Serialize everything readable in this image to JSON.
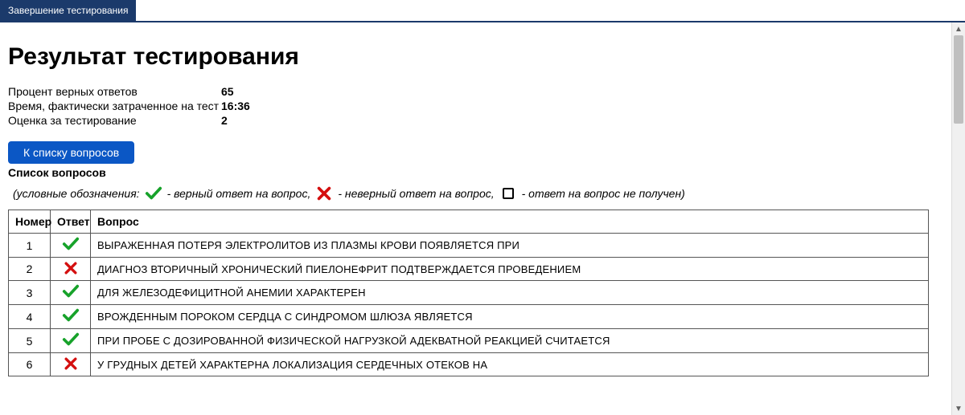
{
  "top_tab": "Завершение тестирования",
  "title": "Результат тестирования",
  "stats": {
    "rows": [
      {
        "label": "Процент верных ответов",
        "value": "65"
      },
      {
        "label": "Время, фактически затраченное на тест",
        "value": "16:36"
      },
      {
        "label": "Оценка за тестирование",
        "value": "2"
      }
    ]
  },
  "button_list_label": "К списку вопросов",
  "list_title": "Список вопросов",
  "legend": {
    "prefix": "(условные обозначения:",
    "correct": " - верный ответ на вопрос,",
    "wrong": " - неверный ответ на вопрос,",
    "none": " - ответ на вопрос не получен)"
  },
  "icons": {
    "check_color": "#17a22a",
    "cross_color": "#d40f0f"
  },
  "table": {
    "headers": {
      "num": "Номер",
      "ans": "Ответ",
      "q": "Вопрос"
    },
    "rows": [
      {
        "num": "1",
        "status": "correct",
        "q": "ВЫРАЖЕННАЯ ПОТЕРЯ ЭЛЕКТРОЛИТОВ ИЗ ПЛАЗМЫ КРОВИ ПОЯВЛЯЕТСЯ ПРИ"
      },
      {
        "num": "2",
        "status": "wrong",
        "q": "ДИАГНОЗ ВТОРИЧНЫЙ ХРОНИЧЕСКИЙ ПИЕЛОНЕФРИТ ПОДТВЕРЖДАЕТСЯ ПРОВЕДЕНИЕМ"
      },
      {
        "num": "3",
        "status": "correct",
        "q": "ДЛЯ ЖЕЛЕЗОДЕФИЦИТНОЙ АНЕМИИ ХАРАКТЕРЕН"
      },
      {
        "num": "4",
        "status": "correct",
        "q": "ВРОЖДЕННЫМ ПОРОКОМ СЕРДЦА С СИНДРОМОМ ШЛЮЗА ЯВЛЯЕТСЯ"
      },
      {
        "num": "5",
        "status": "correct",
        "q": "ПРИ ПРОБЕ С ДОЗИРОВАННОЙ ФИЗИЧЕСКОЙ НАГРУЗКОЙ АДЕКВАТНОЙ РЕАКЦИЕЙ СЧИТАЕТСЯ"
      },
      {
        "num": "6",
        "status": "wrong",
        "q": "У ГРУДНЫХ ДЕТЕЙ ХАРАКТЕРНА ЛОКАЛИЗАЦИЯ СЕРДЕЧНЫХ ОТЕКОВ НА"
      }
    ]
  }
}
